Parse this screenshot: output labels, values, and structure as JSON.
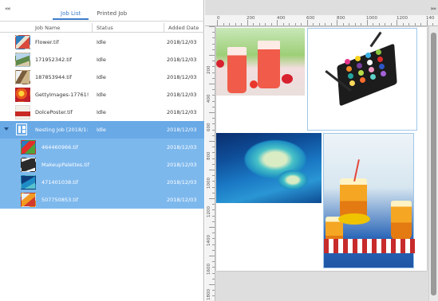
{
  "left_panel": {
    "collapse_glyph": "««",
    "tabs": [
      {
        "label": "Job List",
        "active": true
      },
      {
        "label": "Printed Job",
        "active": false
      }
    ],
    "columns": [
      "Job Name",
      "Status",
      "Added Date"
    ],
    "rows": [
      {
        "name": "Flower.tif",
        "status": "Idle",
        "date": "2018/12/03",
        "thumb": "flower-thumbnail",
        "selected": false
      },
      {
        "name": "171952342.tif",
        "status": "Idle",
        "date": "2018/12/03",
        "thumb": "landscape-thumbnail",
        "selected": false
      },
      {
        "name": "187853944.tif",
        "status": "Idle",
        "date": "2018/12/03",
        "thumb": "interior-thumbnail",
        "selected": false
      },
      {
        "name": "GettyImages-17761!",
        "status": "Idle",
        "date": "2018/12/03",
        "thumb": "fruit-thumbnail",
        "selected": false
      },
      {
        "name": "DolcePoster.tif",
        "status": "Idle",
        "date": "2018/12/03",
        "thumb": "poster-thumbnail",
        "selected": false
      },
      {
        "name": "Nesting Job [2018/1:",
        "status": "Idle",
        "date": "2018/12/03",
        "thumb": "nesting-layout-icon",
        "selected": true,
        "group": true
      },
      {
        "name": "464460966.tif",
        "status": "",
        "date": "2018/12/03",
        "thumb": "drink-thumbnail",
        "selected": true,
        "child": true
      },
      {
        "name": "MakeupPalettes.tif",
        "status": "",
        "date": "2018/12/03",
        "thumb": "palette-thumbnail",
        "selected": true,
        "child": true
      },
      {
        "name": "471401038.tif",
        "status": "",
        "date": "2018/12/03",
        "thumb": "island-thumbnail",
        "selected": true,
        "child": true
      },
      {
        "name": "507750853.tif",
        "status": "",
        "date": "2018/12/03",
        "thumb": "juice-thumbnail",
        "selected": true,
        "child": true
      }
    ]
  },
  "canvas": {
    "expand_glyph": "»»",
    "ruler_h_labels": [
      "0",
      "200",
      "400",
      "600",
      "800",
      "1000",
      "1200",
      "140"
    ],
    "ruler_v_labels": [
      "200",
      "400",
      "600",
      "800",
      "1000",
      "1200",
      "1400",
      "1600",
      "1800"
    ],
    "images": [
      "drink-image",
      "makeup-palette-image",
      "island-image",
      "juice-image"
    ],
    "colors": {
      "selection": "#7db8ed",
      "tab_active": "#3b7cc9",
      "canvas_bg": "#dedede"
    }
  }
}
